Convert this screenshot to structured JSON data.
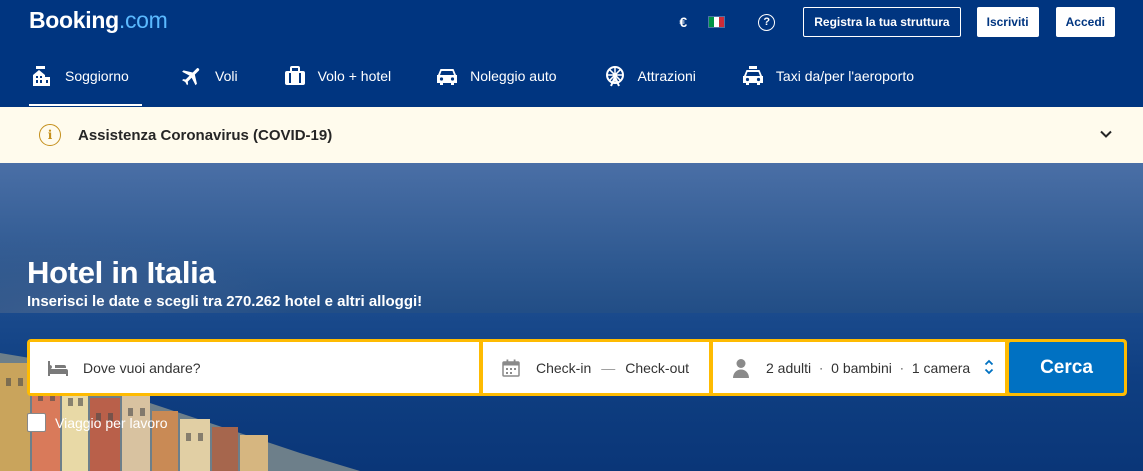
{
  "header": {
    "logo_main": "Booking",
    "logo_suffix": ".com",
    "currency": "€",
    "help_icon": "?",
    "register_property": "Registra la tua struttura",
    "signup": "Iscriviti",
    "login": "Accedi"
  },
  "nav": {
    "items": [
      {
        "label": "Soggiorno",
        "icon": "bed-icon",
        "active": true
      },
      {
        "label": "Voli",
        "icon": "plane-icon"
      },
      {
        "label": "Volo + hotel",
        "icon": "suitcase-icon"
      },
      {
        "label": "Noleggio auto",
        "icon": "car-icon"
      },
      {
        "label": "Attrazioni",
        "icon": "ferris-wheel-icon"
      },
      {
        "label": "Taxi da/per l'aeroporto",
        "icon": "taxi-icon"
      }
    ]
  },
  "covid": {
    "info_icon": "i",
    "text": "Assistenza Coronavirus (COVID-19)"
  },
  "hero": {
    "title": "Hotel in Italia",
    "subtitle": "Inserisci le date e scegli tra 270.262 hotel e altri alloggi!"
  },
  "search": {
    "destination_placeholder": "Dove vuoi andare?",
    "checkin": "Check-in",
    "date_separator": "—",
    "checkout": "Check-out",
    "adults": "2 adulti",
    "separator": "·",
    "children": "0 bambini",
    "rooms": "1 camera",
    "submit": "Cerca"
  },
  "business_travel": {
    "label": "Viaggio per lavoro",
    "checked": false
  },
  "colors": {
    "brand_blue": "#003580",
    "accent_yellow": "#febb02",
    "button_blue": "#0071c2",
    "covid_bg": "#fffbed"
  }
}
